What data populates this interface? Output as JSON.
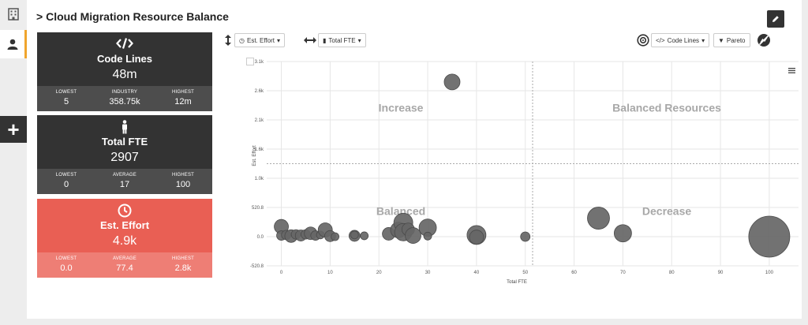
{
  "page": {
    "title": "Cloud Migration Resource Balance"
  },
  "cards": [
    {
      "label": "Code Lines",
      "value": "48m",
      "stats": [
        {
          "k": "LOWEST",
          "v": "5"
        },
        {
          "k": "INDUSTRY",
          "v": "358.75k"
        },
        {
          "k": "HIGHEST",
          "v": "12m"
        }
      ]
    },
    {
      "label": "Total FTE",
      "value": "2907",
      "stats": [
        {
          "k": "LOWEST",
          "v": "0"
        },
        {
          "k": "AVERAGE",
          "v": "17"
        },
        {
          "k": "HIGHEST",
          "v": "100"
        }
      ]
    },
    {
      "label": "Est. Effort",
      "value": "4.9k",
      "stats": [
        {
          "k": "LOWEST",
          "v": "0.0"
        },
        {
          "k": "AVERAGE",
          "v": "77.4"
        },
        {
          "k": "HIGHEST",
          "v": "2.8k"
        }
      ]
    }
  ],
  "controls": {
    "y_select": "Est. Effort",
    "x_select": "Total FTE",
    "size_select": "Code Lines",
    "pareto": "Pareto"
  },
  "colors": {
    "accent": "#f0a52d",
    "card_dark": "#333333",
    "card_red": "#e95f54",
    "bubble": "#666666"
  },
  "chart_data": {
    "type": "scatter",
    "xlabel": "Total FTE",
    "ylabel": "Est. Effort",
    "xlim": [
      -3,
      106
    ],
    "ylim": [
      -520.8,
      3100
    ],
    "x_ticks": [
      "0",
      "10",
      "20",
      "30",
      "40",
      "50",
      "60",
      "70",
      "80",
      "90",
      "100"
    ],
    "y_ticks": [
      {
        "v": -520.8,
        "t": "-520.8"
      },
      {
        "v": 0,
        "t": "0.0"
      },
      {
        "v": 520.8,
        "t": "520.8"
      },
      {
        "v": 1000,
        "t": "1.0k"
      },
      {
        "v": 1600,
        "t": "1.6k"
      },
      {
        "v": 2100,
        "t": "2.1k"
      },
      {
        "v": 2600,
        "t": "2.6k"
      },
      {
        "v": 3100,
        "t": "3.1k"
      }
    ],
    "x_divider": 51.5,
    "y_divider": 1300,
    "quadrants": [
      {
        "label": "Increase",
        "x": 24.5,
        "y": 2240
      },
      {
        "label": "Balanced Resources",
        "x": 79,
        "y": 2240
      },
      {
        "label": "Balanced",
        "x": 24.5,
        "y": 390
      },
      {
        "label": "Decrease",
        "x": 79,
        "y": 390
      }
    ],
    "points": [
      {
        "x": 35,
        "y": 2750,
        "r": 10
      },
      {
        "x": 0,
        "y": 180,
        "r": 9
      },
      {
        "x": 0,
        "y": 20,
        "r": 6
      },
      {
        "x": 1,
        "y": 30,
        "r": 6
      },
      {
        "x": 2,
        "y": 10,
        "r": 8
      },
      {
        "x": 3,
        "y": 40,
        "r": 6
      },
      {
        "x": 4,
        "y": 20,
        "r": 7
      },
      {
        "x": 5,
        "y": 40,
        "r": 6
      },
      {
        "x": 6,
        "y": 60,
        "r": 8
      },
      {
        "x": 7,
        "y": 20,
        "r": 6
      },
      {
        "x": 8,
        "y": 30,
        "r": 5
      },
      {
        "x": 9,
        "y": 120,
        "r": 9
      },
      {
        "x": 10,
        "y": 10,
        "r": 7
      },
      {
        "x": 11,
        "y": 0,
        "r": 5
      },
      {
        "x": 15,
        "y": 15,
        "r": 7
      },
      {
        "x": 15,
        "y": 30,
        "r": 5
      },
      {
        "x": 17,
        "y": 15,
        "r": 5
      },
      {
        "x": 22,
        "y": 50,
        "r": 8
      },
      {
        "x": 24,
        "y": 120,
        "r": 10
      },
      {
        "x": 25,
        "y": 250,
        "r": 12
      },
      {
        "x": 25,
        "y": 80,
        "r": 11
      },
      {
        "x": 26,
        "y": 130,
        "r": 8
      },
      {
        "x": 27,
        "y": 20,
        "r": 10
      },
      {
        "x": 30,
        "y": 160,
        "r": 11
      },
      {
        "x": 30,
        "y": 10,
        "r": 5
      },
      {
        "x": 40,
        "y": 30,
        "r": 12
      },
      {
        "x": 40,
        "y": -10,
        "r": 9
      },
      {
        "x": 50,
        "y": 0,
        "r": 6
      },
      {
        "x": 65,
        "y": 330,
        "r": 14
      },
      {
        "x": 70,
        "y": 60,
        "r": 11
      },
      {
        "x": 100,
        "y": 0,
        "r": 26
      }
    ]
  }
}
